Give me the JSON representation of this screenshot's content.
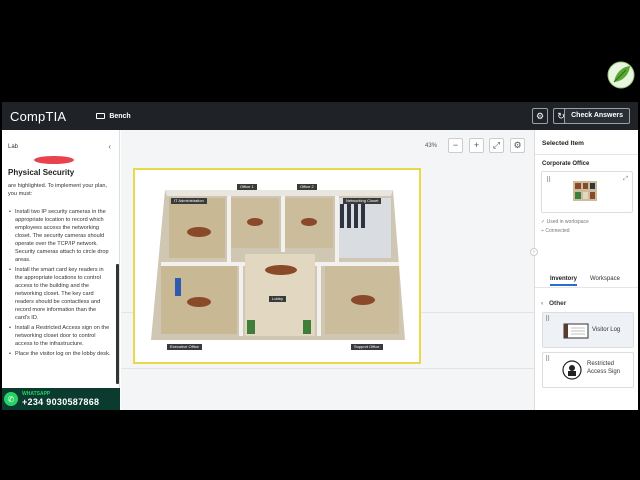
{
  "app": {
    "brand": "CompTIA",
    "bench_label": "Bench",
    "check_answers_label": "Check Answers"
  },
  "left_panel": {
    "lab_label": "Lab",
    "title": "Physical Security",
    "intro": "are highlighted. To implement your plan, you must:",
    "bullets": [
      "Install two IP security cameras in the appropriate location to record which employees access the networking closet. The security cameras should operate over the TCP/IP network. Security cameras attach to circle drop areas.",
      "Install the smart card key readers in the appropriate locations to control access to the building and the networking closet. The key card readers should be contactless and record more information than the card's ID.",
      "Install a Restricted Access sign on the networking closet door to control access to the infrastructure.",
      "Place the visitor log on the lobby desk."
    ]
  },
  "whatsapp": {
    "label": "WHATSAPP",
    "number": "+234 9030587868"
  },
  "canvas": {
    "zoom": "43%",
    "rooms": {
      "it_admin": "IT Administration",
      "office1": "Office 1",
      "office2": "Office 2",
      "networking_closet": "Networking Closet",
      "lobby": "Lobby",
      "executive_office": "Executive Office",
      "support_office": "Support Office"
    }
  },
  "right_panel": {
    "title": "Selected Item",
    "selected_name": "Corporate Office",
    "used_in_workspace": "Used in workspace",
    "connected": "Connected",
    "tabs": [
      "Inventory",
      "Workspace"
    ],
    "active_tab": "Inventory",
    "group_label": "Other",
    "items": [
      {
        "label": "Visitor Log"
      },
      {
        "label": "Restricted Access Sign"
      }
    ]
  },
  "colors": {
    "topbar": "#1f2328",
    "accent": "#2a6bd1",
    "plan_border": "#e8d84a",
    "whatsapp": "#25d366"
  }
}
